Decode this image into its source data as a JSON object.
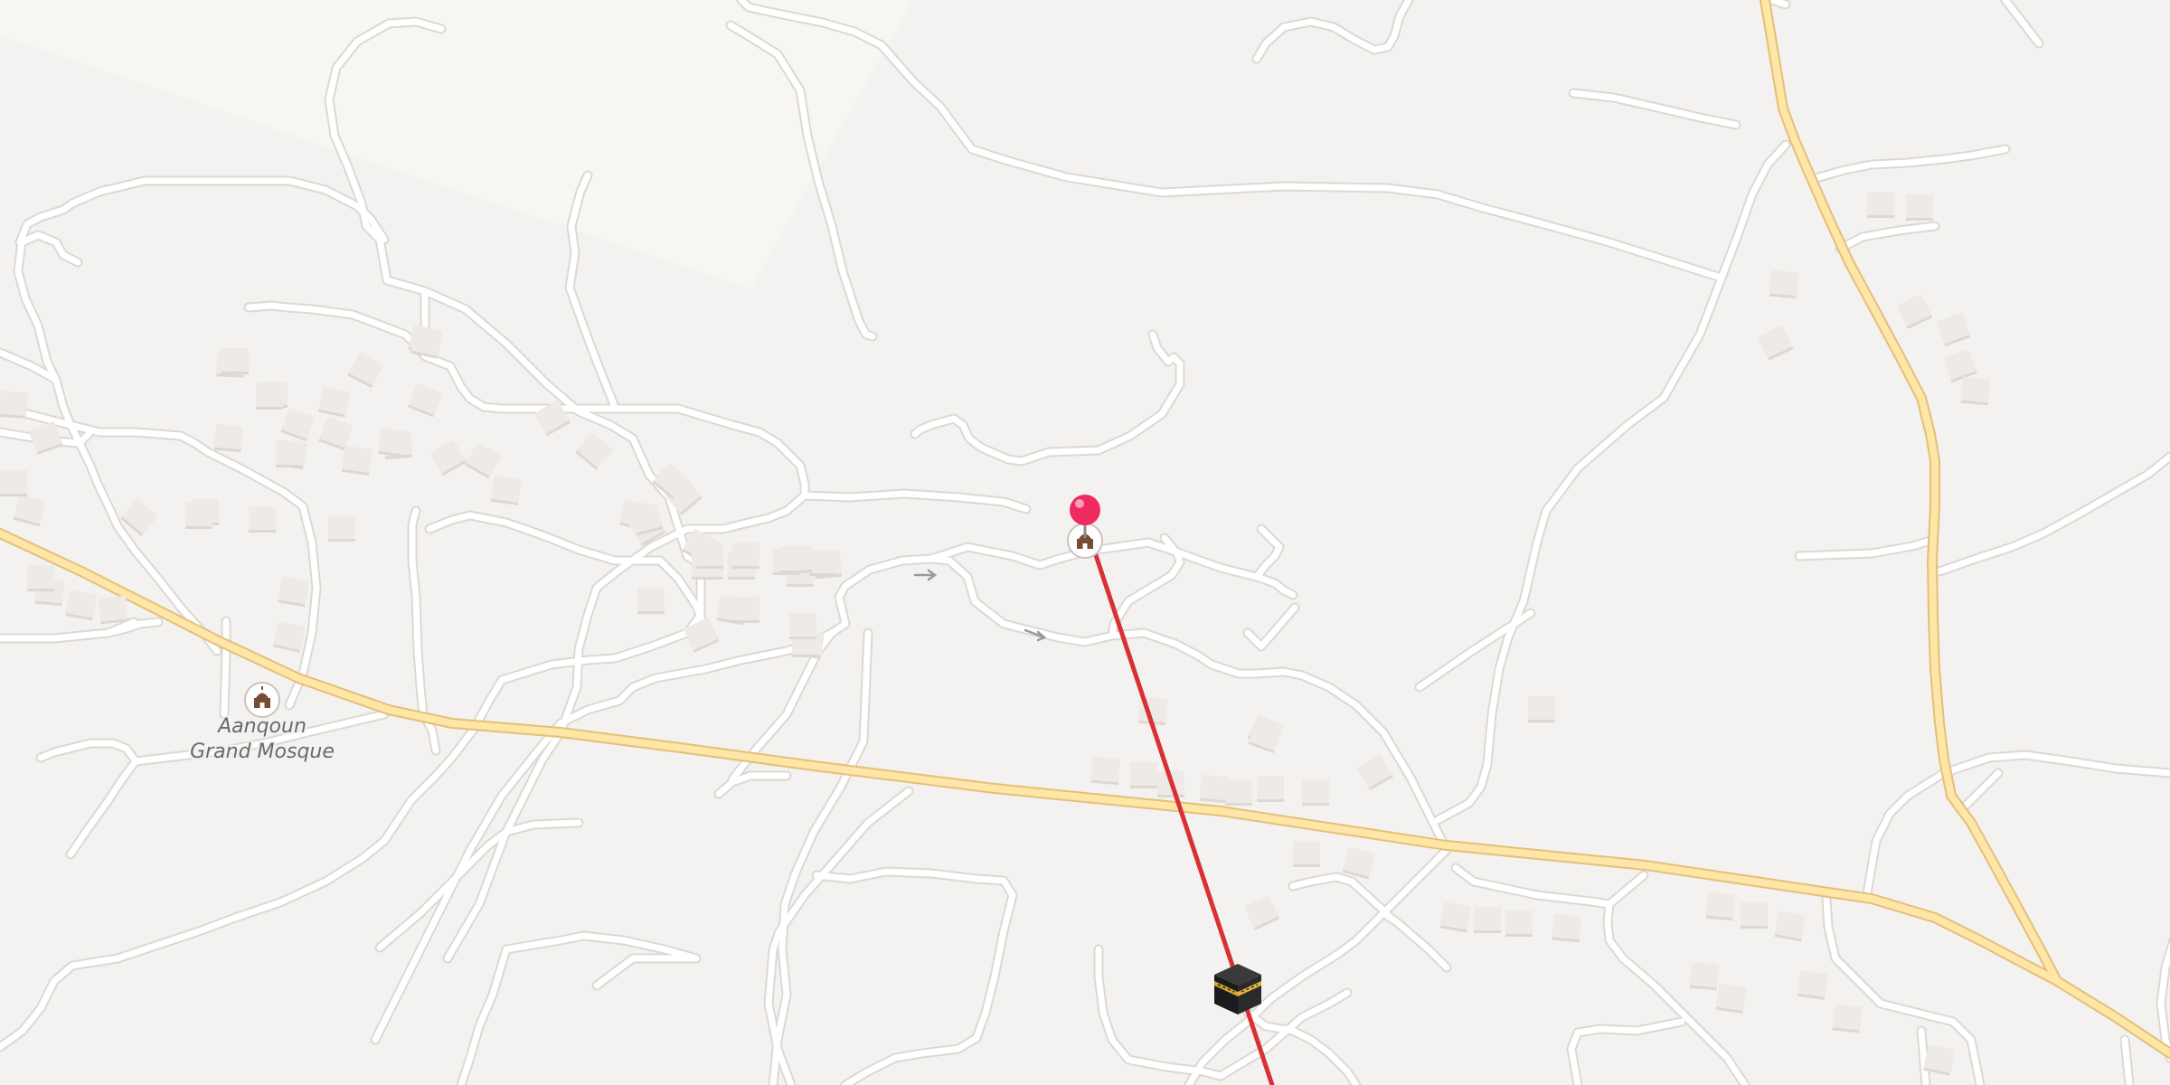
{
  "map": {
    "colors": {
      "background": "#f4f2f0",
      "minor_road": "#ffffff",
      "minor_road_casing": "#dedbd7",
      "major_road": "#fde5a2",
      "major_road_casing": "#e6c17a",
      "building": "#eeeae5",
      "building_shadow": "#ddd8d1",
      "route_line": "#d93036",
      "pin": "#ee2a5f",
      "label_text": "#6a6a6a"
    },
    "pois": [
      {
        "name": "Aanqoun Grand Mosque",
        "label_lines": [
          "Aanqoun",
          "Grand Mosque"
        ],
        "icon": "mosque-icon"
      },
      {
        "name": "",
        "label_lines": [],
        "icon": "mosque-icon"
      }
    ],
    "markers": {
      "origin": {
        "icon": "location-pin-icon",
        "color": "#ee2a5f"
      },
      "destination": {
        "icon": "kaaba-icon"
      }
    },
    "overlay": {
      "type": "qibla-direction-line",
      "color": "#d93036"
    },
    "one_way_arrow_icon": "arrow-right-icon"
  }
}
